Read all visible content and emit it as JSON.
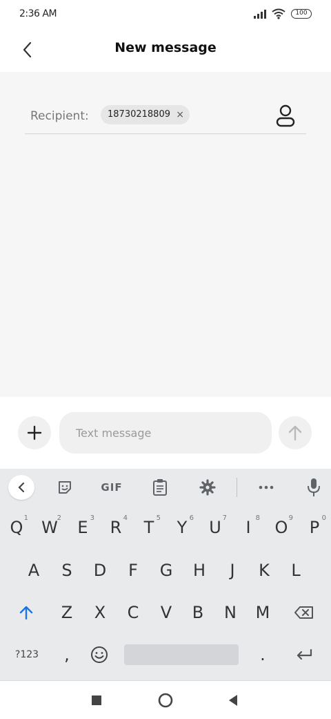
{
  "status_bar": {
    "time": "2:36 AM",
    "battery": "100",
    "signal_icon": "signal-icon",
    "wifi_icon": "wifi-icon"
  },
  "header": {
    "title": "New message",
    "back_icon": "back-arrow-icon"
  },
  "recipient": {
    "label": "Recipient:",
    "chip_value": "18730218809",
    "chip_remove": "×",
    "contact_icon": "contact-person-icon"
  },
  "composer": {
    "placeholder": "Text message",
    "add_icon": "plus-icon",
    "send_icon": "send-arrow-icon"
  },
  "keyboard": {
    "toolbar": {
      "gif_label": "GIF",
      "icons": [
        "collapse-chevron-icon",
        "sticker-icon",
        "clipboard-icon",
        "settings-gear-icon",
        "more-dots-icon",
        "microphone-icon"
      ]
    },
    "row1": [
      {
        "key": "Q",
        "hint": "1"
      },
      {
        "key": "W",
        "hint": "2"
      },
      {
        "key": "E",
        "hint": "3"
      },
      {
        "key": "R",
        "hint": "4"
      },
      {
        "key": "T",
        "hint": "5"
      },
      {
        "key": "Y",
        "hint": "6"
      },
      {
        "key": "U",
        "hint": "7"
      },
      {
        "key": "I",
        "hint": "8"
      },
      {
        "key": "O",
        "hint": "9"
      },
      {
        "key": "P",
        "hint": "0"
      }
    ],
    "row2": [
      "A",
      "S",
      "D",
      "F",
      "G",
      "H",
      "J",
      "K",
      "L"
    ],
    "row3": [
      "Z",
      "X",
      "C",
      "V",
      "B",
      "N",
      "M"
    ],
    "symbols_label": "?123",
    "comma": ",",
    "period": ".",
    "accent_color": "#1a73e8"
  },
  "nav_bar": {
    "icons": [
      "recents-square-icon",
      "home-circle-icon",
      "back-triangle-icon"
    ]
  }
}
